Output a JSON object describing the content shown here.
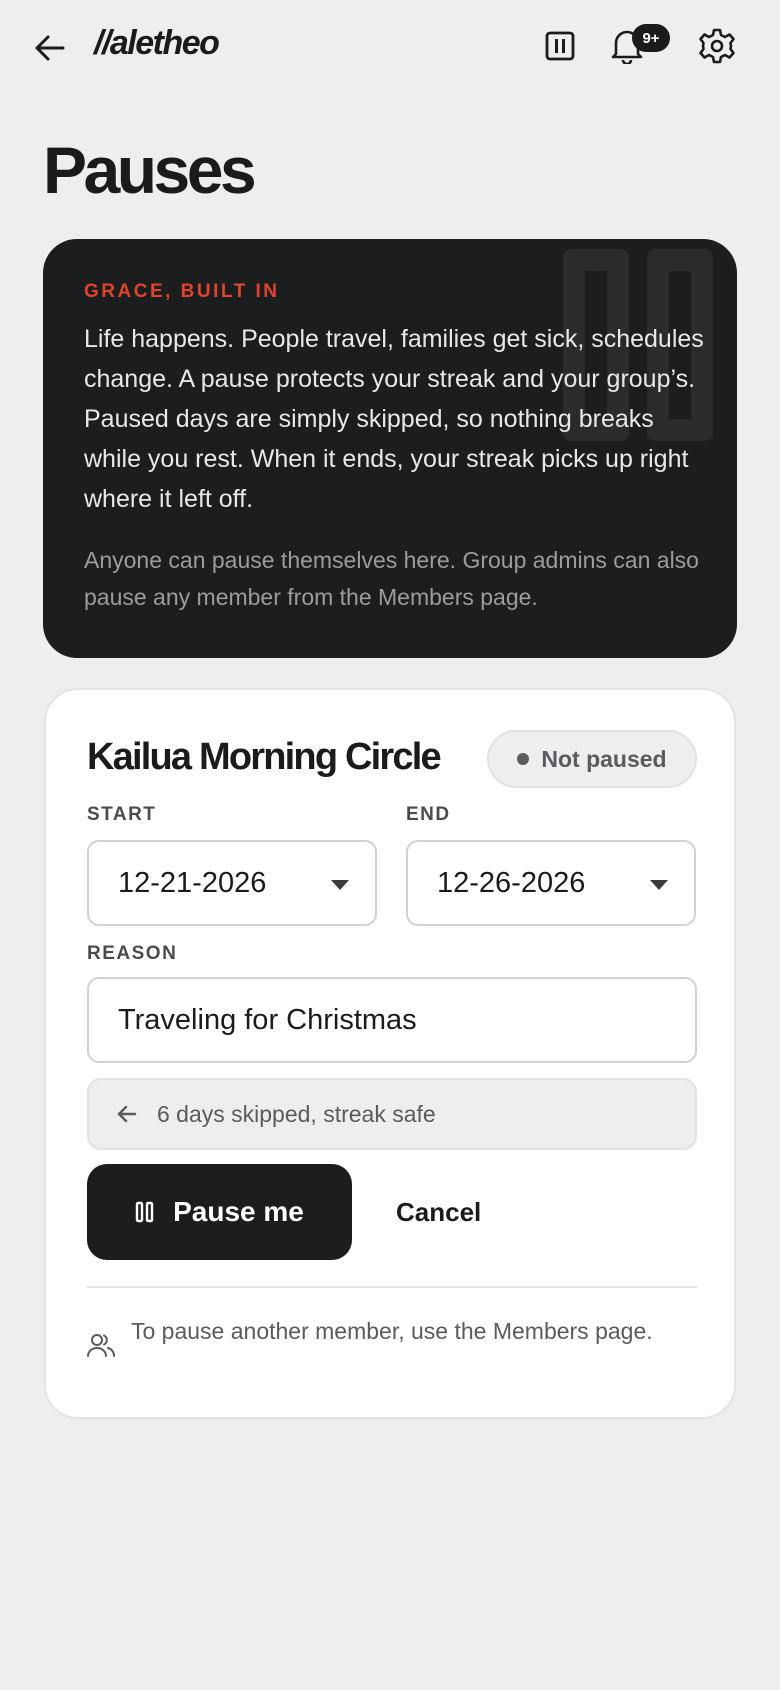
{
  "header": {
    "logo": "//aletheo",
    "notification_badge": "9+",
    "icons": [
      "back-arrow-icon",
      "pause-icon",
      "bell-icon",
      "gear-icon"
    ]
  },
  "page": {
    "title": "Pauses"
  },
  "info": {
    "kicker": "GRACE, BUILT IN",
    "body": "Life happens. People travel, families get sick, schedules change. A pause protects your streak and your group’s. Paused days are simply skipped, so nothing breaks while you rest. When it ends, your streak picks up right where it left off.",
    "note": "Anyone can pause themselves here. Group admins can also pause any member from the Members page."
  },
  "form": {
    "group_name": "Kailua Morning Circle",
    "status": "Not paused",
    "start_label": "START",
    "start_value": "12-21-2026",
    "end_label": "END",
    "end_value": "12-26-2026",
    "reason_label": "REASON",
    "reason_value": "Traveling for Christmas",
    "summary": "6 days skipped, streak safe",
    "pause_button": "Pause me",
    "cancel_button": "Cancel",
    "hint": "To pause another member, use the Members page."
  },
  "colors": {
    "background": "#eeeef1",
    "dark_card": "#1c1d1e",
    "accent": "#e0452c",
    "text": "#1b1b1c",
    "muted": "#5a5a5f"
  }
}
